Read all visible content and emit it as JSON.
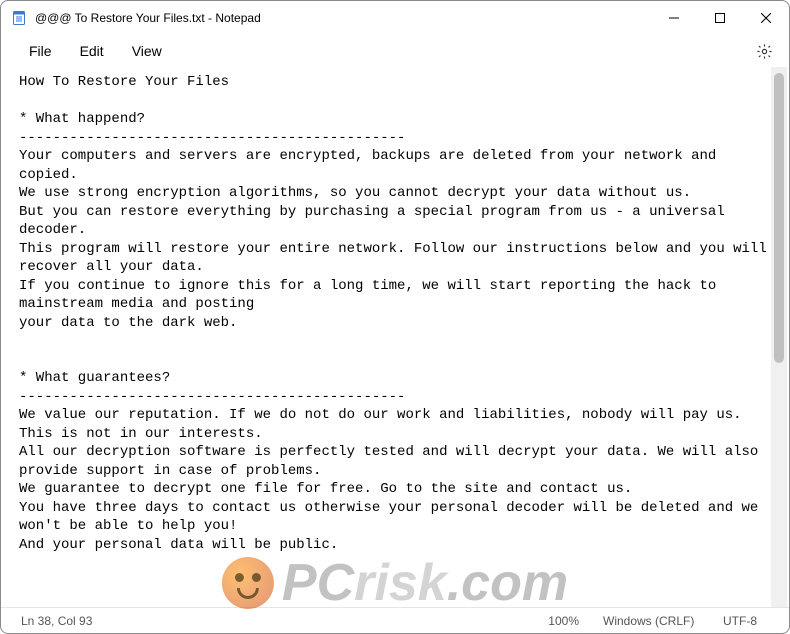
{
  "window": {
    "title": "@@@ To Restore Your Files.txt - Notepad"
  },
  "menu": {
    "file": "File",
    "edit": "Edit",
    "view": "View"
  },
  "document": {
    "text": "How To Restore Your Files\n\n* What happend?\n----------------------------------------------\nYour computers and servers are encrypted, backups are deleted from your network and copied.\nWe use strong encryption algorithms, so you cannot decrypt your data without us.\nBut you can restore everything by purchasing a special program from us - a universal decoder.\nThis program will restore your entire network. Follow our instructions below and you will recover all your data.\nIf you continue to ignore this for a long time, we will start reporting the hack to mainstream media and posting\nyour data to the dark web.\n\n\n* What guarantees?\n----------------------------------------------\nWe value our reputation. If we do not do our work and liabilities, nobody will pay us. This is not in our interests.\nAll our decryption software is perfectly tested and will decrypt your data. We will also provide support in case of problems.\nWe guarantee to decrypt one file for free. Go to the site and contact us.\nYou have three days to contact us otherwise your personal decoder will be deleted and we won't be able to help you!\nAnd your personal data will be public."
  },
  "status": {
    "cursor": "Ln 38, Col 93",
    "zoom": "100%",
    "lineending": "Windows (CRLF)",
    "encoding": "UTF-8"
  },
  "watermark": {
    "prefix": "PC",
    "mid": "risk",
    "suffix": ".com"
  }
}
